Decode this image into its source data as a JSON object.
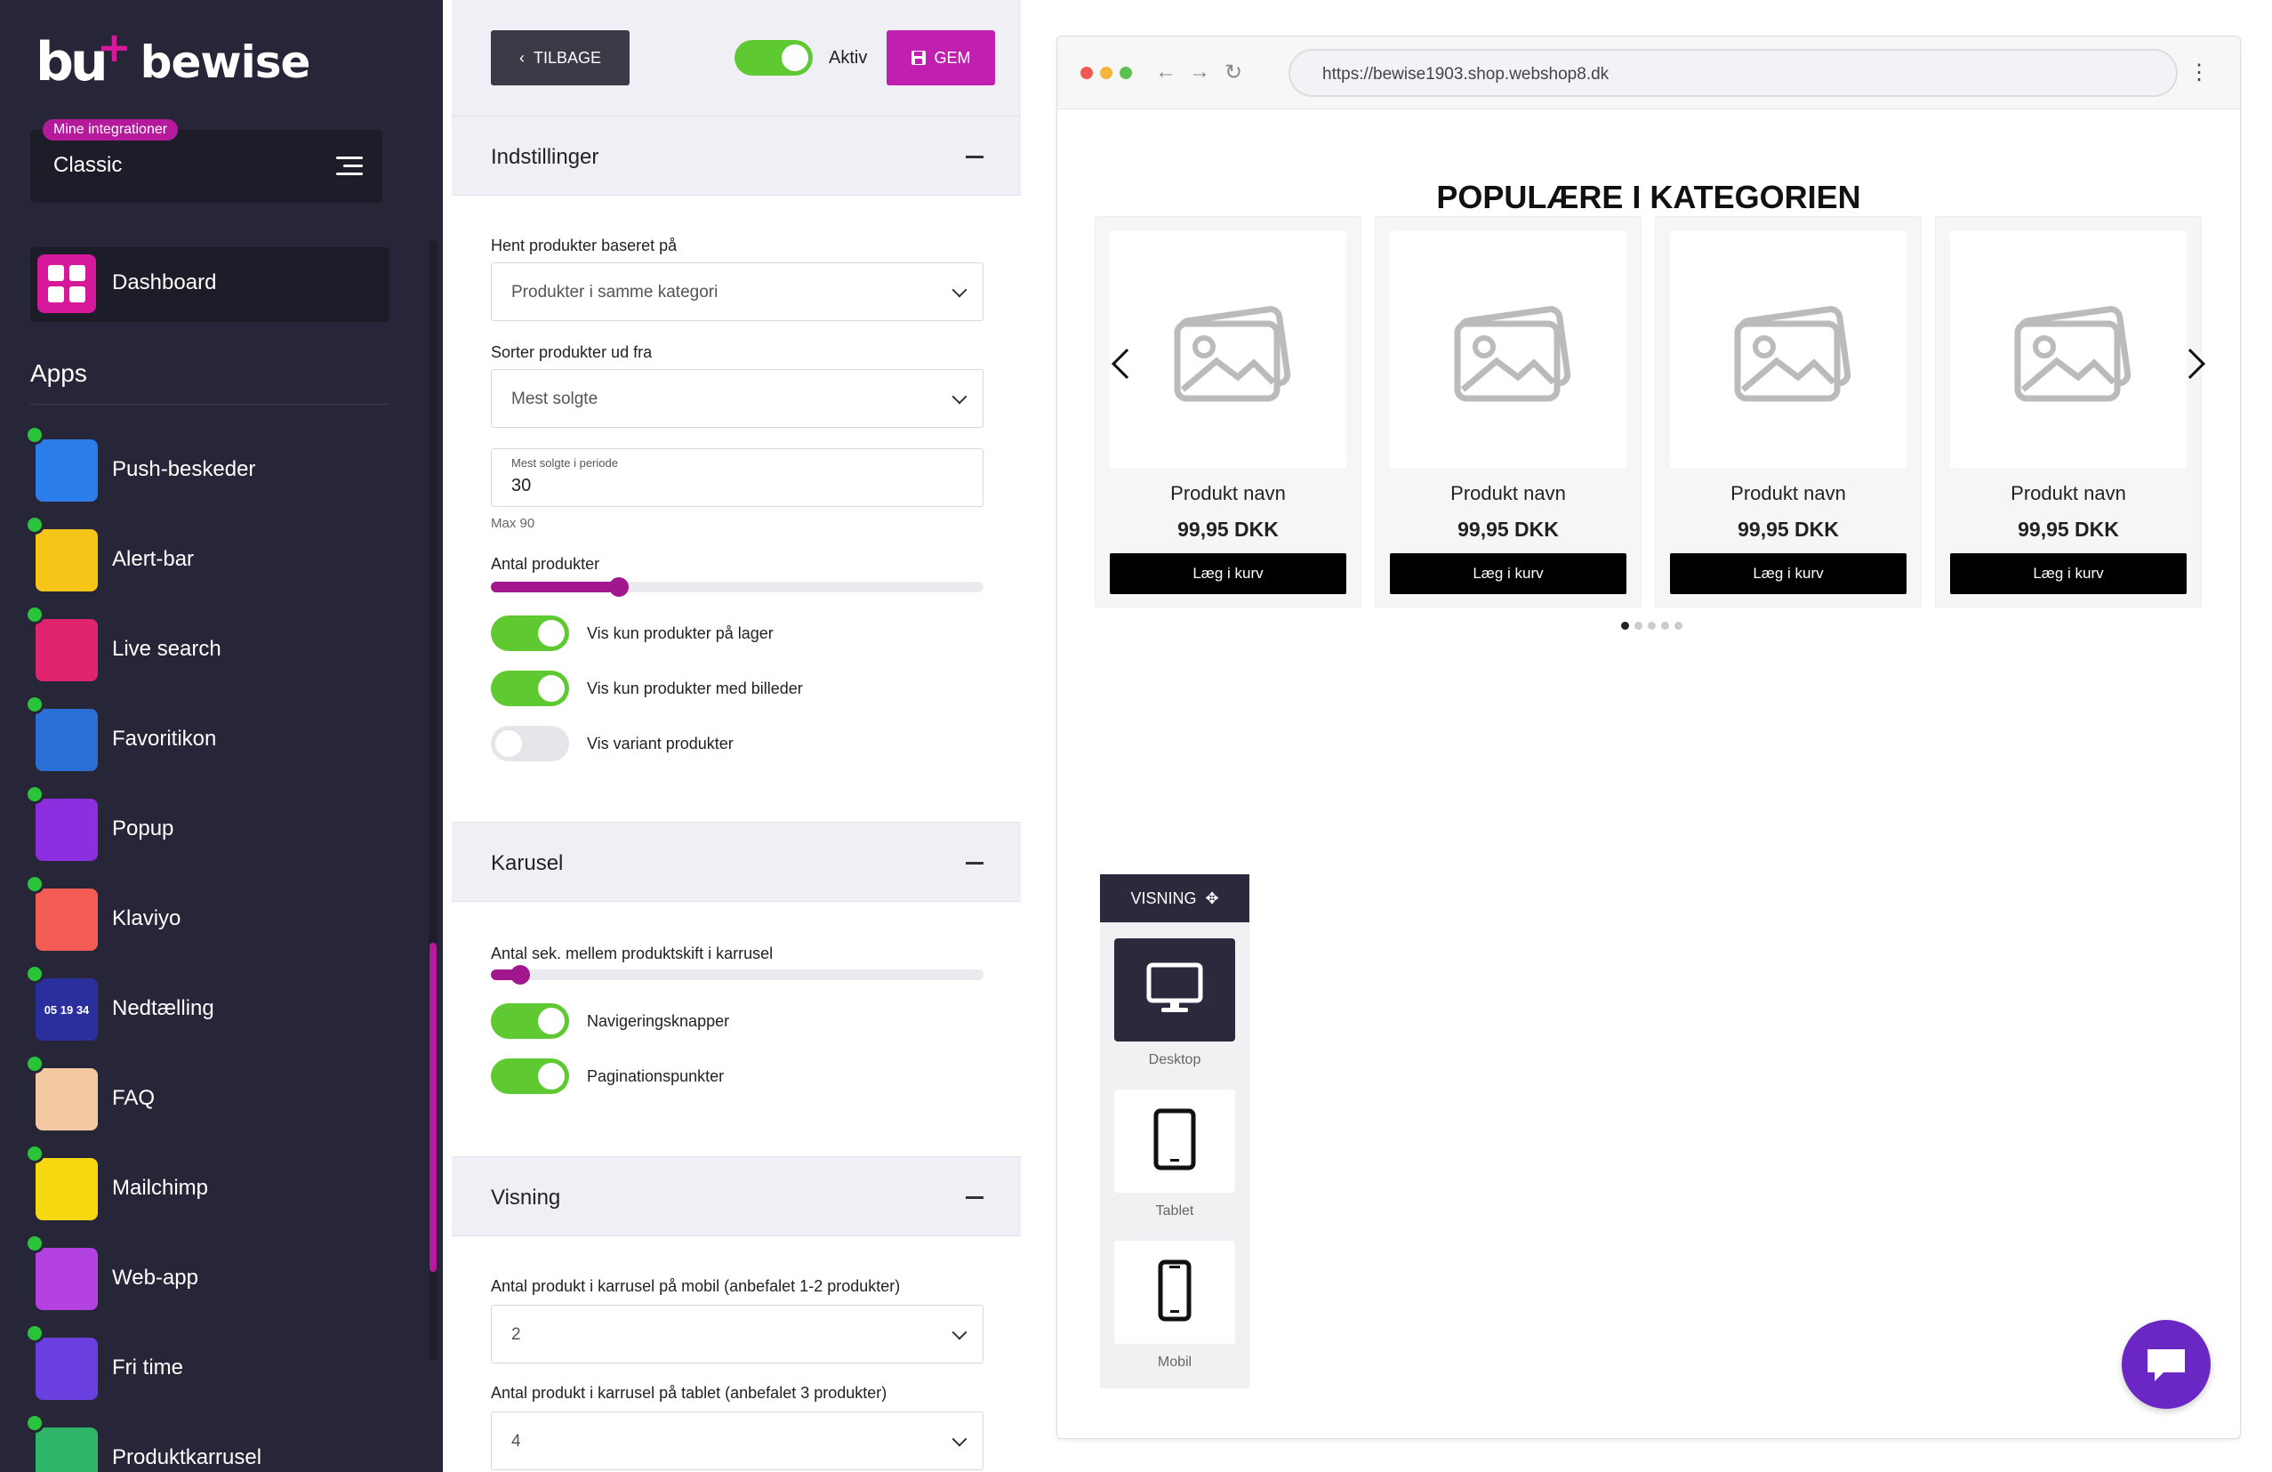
{
  "brand": {
    "name": "bewise",
    "mark": "bu",
    "plus": "+"
  },
  "integration": {
    "badge": "Mine integrationer",
    "name": "Classic"
  },
  "dashboard": {
    "label": "Dashboard"
  },
  "apps_heading": "Apps",
  "apps": [
    {
      "label": "Push-beskeder",
      "color": "#2b7de9",
      "icon": "bell-icon"
    },
    {
      "label": "Alert-bar",
      "color": "#f5c518",
      "icon": "megaphone-icon"
    },
    {
      "label": "Live search",
      "color": "#e0246d",
      "icon": "magnifier-icon"
    },
    {
      "label": "Favoritikon",
      "color": "#2a6fd6",
      "icon": "globe-icon"
    },
    {
      "label": "Popup",
      "color": "#8b2fe0",
      "icon": "cart-icon"
    },
    {
      "label": "Klaviyo",
      "color": "#f25c54",
      "icon": "flag-icon"
    },
    {
      "label": "Nedtælling",
      "color": "#2b2f9e",
      "icon": "countdown-icon",
      "glyph": "05 19 34"
    },
    {
      "label": "FAQ",
      "color": "#f2c9a0",
      "icon": "question-icon"
    },
    {
      "label": "Mailchimp",
      "color": "#f6d810",
      "icon": "monkey-icon"
    },
    {
      "label": "Web-app",
      "color": "#b442e0",
      "icon": "phone-app-icon"
    },
    {
      "label": "Fri time",
      "color": "#6a3fe0",
      "icon": "hourglass-icon"
    },
    {
      "label": "Produktkarrusel",
      "color": "#2fb56a",
      "icon": "shoe-icon"
    }
  ],
  "toolbar": {
    "back_label": "TILBAGE",
    "active_label": "Aktiv",
    "active_on": true,
    "save_label": "GEM"
  },
  "settings": {
    "title": "Indstillinger",
    "fetch_label": "Hent produkter baseret på",
    "fetch_value": "Produkter i samme kategori",
    "sort_label": "Sorter produkter ud fra",
    "sort_value": "Mest solgte",
    "period_label": "Mest solgte i periode",
    "period_value": "30",
    "period_hint": "Max 90",
    "count_label": "Antal produkter",
    "count_fraction": 0.24,
    "toggles": [
      {
        "label": "Vis kun produkter på lager",
        "on": true
      },
      {
        "label": "Vis kun produkter med billeder",
        "on": true
      },
      {
        "label": "Vis variant produkter",
        "on": false
      }
    ]
  },
  "carousel": {
    "title": "Karusel",
    "seconds_label": "Antal sek. mellem produktskift i karrusel",
    "seconds_fraction": 0.04,
    "toggles": [
      {
        "label": "Navigeringsknapper",
        "on": true
      },
      {
        "label": "Paginationspunkter",
        "on": true
      }
    ]
  },
  "display": {
    "title": "Visning",
    "mobile_label": "Antal produkt i karrusel på mobil (anbefalet 1-2 produkter)",
    "mobile_value": "2",
    "tablet_label": "Antal produkt i karrusel på tablet (anbefalet 3 produkter)",
    "tablet_value": "4"
  },
  "preview": {
    "url": "https://bewise1903.shop.webshop8.dk",
    "heading": "POPULÆRE I KATEGORIEN",
    "products": [
      {
        "name": "Produkt navn",
        "price": "99,95 DKK",
        "button": "Læg i kurv"
      },
      {
        "name": "Produkt navn",
        "price": "99,95 DKK",
        "button": "Læg i kurv"
      },
      {
        "name": "Produkt navn",
        "price": "99,95 DKK",
        "button": "Læg i kurv"
      },
      {
        "name": "Produkt navn",
        "price": "99,95 DKK",
        "button": "Læg i kurv"
      }
    ],
    "pagination_total": 5,
    "pagination_active": 1
  },
  "view_panel": {
    "title": "VISNING",
    "devices": [
      {
        "label": "Desktop",
        "active": true
      },
      {
        "label": "Tablet",
        "active": false
      },
      {
        "label": "Mobil",
        "active": false
      }
    ]
  },
  "colors": {
    "accent": "#c11fb0",
    "sidebar": "#272538",
    "toggle_on": "#5fc932",
    "status_dot": "#29c43a",
    "chat": "#6b27c4"
  }
}
